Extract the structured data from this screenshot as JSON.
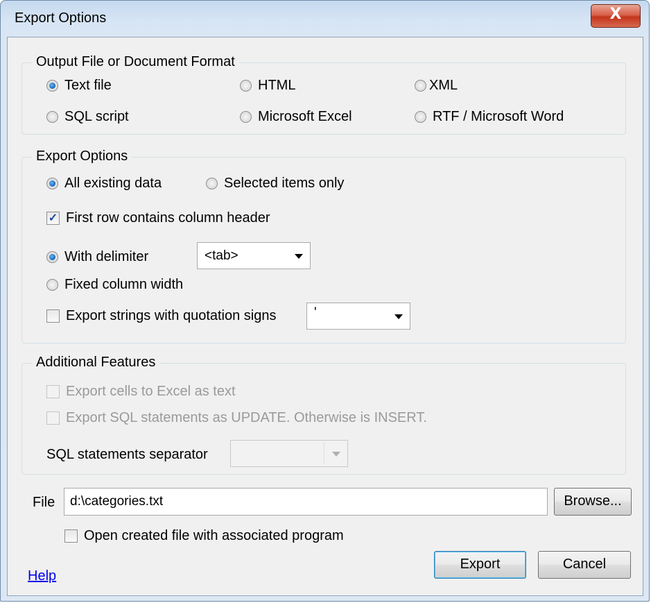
{
  "window": {
    "title": "Export Options",
    "close_glyph": "X"
  },
  "format_group": {
    "title": "Output File or Document Format",
    "options": {
      "text": {
        "label": "Text file",
        "selected": true
      },
      "html": {
        "label": "HTML",
        "selected": false
      },
      "xml": {
        "label": "XML",
        "selected": false
      },
      "sql": {
        "label": "SQL script",
        "selected": false
      },
      "excel": {
        "label": "Microsoft Excel",
        "selected": false
      },
      "rtf": {
        "label": "RTF / Microsoft Word",
        "selected": false
      }
    }
  },
  "export_group": {
    "title": "Export Options",
    "all_data": {
      "label": "All existing data",
      "selected": true
    },
    "selected_only": {
      "label": "Selected items only",
      "selected": false
    },
    "first_row_header": {
      "label": "First row contains column header",
      "checked": true
    },
    "with_delimiter": {
      "label": "With delimiter",
      "selected": true
    },
    "delimiter_value": "<tab>",
    "fixed_width": {
      "label": "Fixed column width",
      "selected": false
    },
    "quote_strings": {
      "label": "Export strings with quotation signs",
      "checked": false
    },
    "quote_value": "'"
  },
  "additional_group": {
    "title": "Additional Features",
    "excel_text": {
      "label": "Export cells to Excel as text",
      "checked": false,
      "enabled": false
    },
    "sql_update": {
      "label": "Export SQL statements as UPDATE. Otherwise is INSERT.",
      "checked": false,
      "enabled": false
    },
    "separator_label": "SQL statements separator",
    "separator_value": ""
  },
  "file": {
    "label": "File",
    "value": "d:\\categories.txt",
    "browse_label": "Browse...",
    "open_created": {
      "label": "Open created file with associated program",
      "checked": false
    }
  },
  "footer": {
    "help_label": "Help",
    "export_label": "Export",
    "cancel_label": "Cancel"
  },
  "icons": {
    "checkmark": "check-icon",
    "dropdown": "chevron-down-icon",
    "close": "close-icon"
  }
}
